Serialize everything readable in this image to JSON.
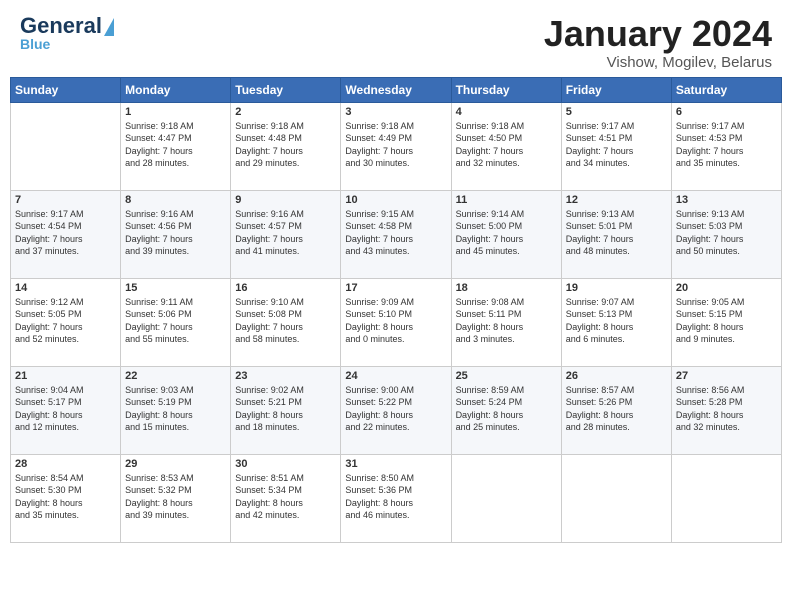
{
  "header": {
    "logo_general": "General",
    "logo_blue": "Blue",
    "month": "January 2024",
    "location": "Vishow, Mogilev, Belarus"
  },
  "days_of_week": [
    "Sunday",
    "Monday",
    "Tuesday",
    "Wednesday",
    "Thursday",
    "Friday",
    "Saturday"
  ],
  "weeks": [
    [
      {
        "day": "",
        "text": ""
      },
      {
        "day": "1",
        "text": "Sunrise: 9:18 AM\nSunset: 4:47 PM\nDaylight: 7 hours\nand 28 minutes."
      },
      {
        "day": "2",
        "text": "Sunrise: 9:18 AM\nSunset: 4:48 PM\nDaylight: 7 hours\nand 29 minutes."
      },
      {
        "day": "3",
        "text": "Sunrise: 9:18 AM\nSunset: 4:49 PM\nDaylight: 7 hours\nand 30 minutes."
      },
      {
        "day": "4",
        "text": "Sunrise: 9:18 AM\nSunset: 4:50 PM\nDaylight: 7 hours\nand 32 minutes."
      },
      {
        "day": "5",
        "text": "Sunrise: 9:17 AM\nSunset: 4:51 PM\nDaylight: 7 hours\nand 34 minutes."
      },
      {
        "day": "6",
        "text": "Sunrise: 9:17 AM\nSunset: 4:53 PM\nDaylight: 7 hours\nand 35 minutes."
      }
    ],
    [
      {
        "day": "7",
        "text": "Sunrise: 9:17 AM\nSunset: 4:54 PM\nDaylight: 7 hours\nand 37 minutes."
      },
      {
        "day": "8",
        "text": "Sunrise: 9:16 AM\nSunset: 4:56 PM\nDaylight: 7 hours\nand 39 minutes."
      },
      {
        "day": "9",
        "text": "Sunrise: 9:16 AM\nSunset: 4:57 PM\nDaylight: 7 hours\nand 41 minutes."
      },
      {
        "day": "10",
        "text": "Sunrise: 9:15 AM\nSunset: 4:58 PM\nDaylight: 7 hours\nand 43 minutes."
      },
      {
        "day": "11",
        "text": "Sunrise: 9:14 AM\nSunset: 5:00 PM\nDaylight: 7 hours\nand 45 minutes."
      },
      {
        "day": "12",
        "text": "Sunrise: 9:13 AM\nSunset: 5:01 PM\nDaylight: 7 hours\nand 48 minutes."
      },
      {
        "day": "13",
        "text": "Sunrise: 9:13 AM\nSunset: 5:03 PM\nDaylight: 7 hours\nand 50 minutes."
      }
    ],
    [
      {
        "day": "14",
        "text": "Sunrise: 9:12 AM\nSunset: 5:05 PM\nDaylight: 7 hours\nand 52 minutes."
      },
      {
        "day": "15",
        "text": "Sunrise: 9:11 AM\nSunset: 5:06 PM\nDaylight: 7 hours\nand 55 minutes."
      },
      {
        "day": "16",
        "text": "Sunrise: 9:10 AM\nSunset: 5:08 PM\nDaylight: 7 hours\nand 58 minutes."
      },
      {
        "day": "17",
        "text": "Sunrise: 9:09 AM\nSunset: 5:10 PM\nDaylight: 8 hours\nand 0 minutes."
      },
      {
        "day": "18",
        "text": "Sunrise: 9:08 AM\nSunset: 5:11 PM\nDaylight: 8 hours\nand 3 minutes."
      },
      {
        "day": "19",
        "text": "Sunrise: 9:07 AM\nSunset: 5:13 PM\nDaylight: 8 hours\nand 6 minutes."
      },
      {
        "day": "20",
        "text": "Sunrise: 9:05 AM\nSunset: 5:15 PM\nDaylight: 8 hours\nand 9 minutes."
      }
    ],
    [
      {
        "day": "21",
        "text": "Sunrise: 9:04 AM\nSunset: 5:17 PM\nDaylight: 8 hours\nand 12 minutes."
      },
      {
        "day": "22",
        "text": "Sunrise: 9:03 AM\nSunset: 5:19 PM\nDaylight: 8 hours\nand 15 minutes."
      },
      {
        "day": "23",
        "text": "Sunrise: 9:02 AM\nSunset: 5:21 PM\nDaylight: 8 hours\nand 18 minutes."
      },
      {
        "day": "24",
        "text": "Sunrise: 9:00 AM\nSunset: 5:22 PM\nDaylight: 8 hours\nand 22 minutes."
      },
      {
        "day": "25",
        "text": "Sunrise: 8:59 AM\nSunset: 5:24 PM\nDaylight: 8 hours\nand 25 minutes."
      },
      {
        "day": "26",
        "text": "Sunrise: 8:57 AM\nSunset: 5:26 PM\nDaylight: 8 hours\nand 28 minutes."
      },
      {
        "day": "27",
        "text": "Sunrise: 8:56 AM\nSunset: 5:28 PM\nDaylight: 8 hours\nand 32 minutes."
      }
    ],
    [
      {
        "day": "28",
        "text": "Sunrise: 8:54 AM\nSunset: 5:30 PM\nDaylight: 8 hours\nand 35 minutes."
      },
      {
        "day": "29",
        "text": "Sunrise: 8:53 AM\nSunset: 5:32 PM\nDaylight: 8 hours\nand 39 minutes."
      },
      {
        "day": "30",
        "text": "Sunrise: 8:51 AM\nSunset: 5:34 PM\nDaylight: 8 hours\nand 42 minutes."
      },
      {
        "day": "31",
        "text": "Sunrise: 8:50 AM\nSunset: 5:36 PM\nDaylight: 8 hours\nand 46 minutes."
      },
      {
        "day": "",
        "text": ""
      },
      {
        "day": "",
        "text": ""
      },
      {
        "day": "",
        "text": ""
      }
    ]
  ]
}
